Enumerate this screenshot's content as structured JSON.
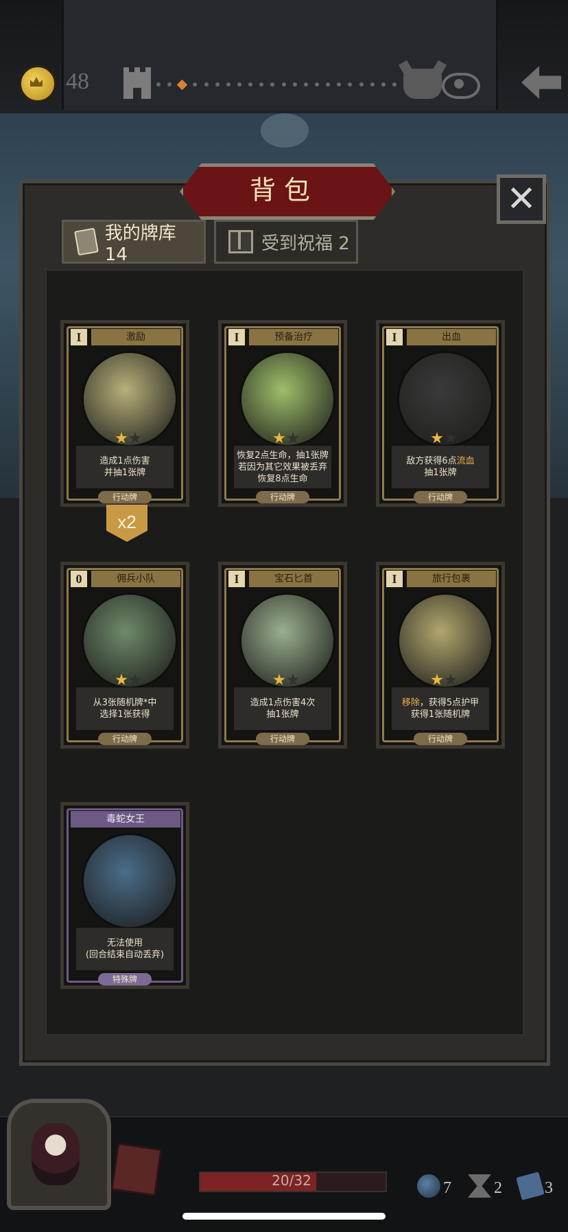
{
  "header": {
    "gold": "48",
    "path_dot_count": 22,
    "path_current_index": 2
  },
  "panel": {
    "title": "背包",
    "close_label": "✕",
    "tabs": [
      {
        "label": "我的牌库 14"
      },
      {
        "label": "受到祝福 2"
      }
    ]
  },
  "cards": [
    {
      "name": "激励",
      "cost": "I",
      "stars": 1,
      "desc": "造成1点伤害\n并抽1张牌",
      "type": "行动牌",
      "art_color": "#b7b07a"
    },
    {
      "name": "预备治疗",
      "cost": "I",
      "stars": 1,
      "desc": "恢复2点生命，抽1张牌\n若因为其它效果被丢弃\n恢复8点生命",
      "type": "行动牌",
      "art_color": "#9fbf6a"
    },
    {
      "name": "出血",
      "cost": "I",
      "stars": 1,
      "desc_parts": [
        "敌方获得6点",
        "流血",
        "\n抽1张牌"
      ],
      "type": "行动牌",
      "art_color": "#3a3a3a"
    },
    {
      "name": "佣兵小队",
      "cost": "0",
      "stars": 1,
      "desc": "从3张随机牌*中\n选择1张获得",
      "type": "行动牌",
      "art_color": "#6f8a6a"
    },
    {
      "name": "宝石匕首",
      "cost": "I",
      "stars": 1,
      "desc": "造成1点伤害4次\n抽1张牌",
      "type": "行动牌",
      "art_color": "#9ab08f"
    },
    {
      "name": "旅行包裹",
      "cost": "I",
      "stars": 1,
      "desc_parts": [
        "移除",
        "，获得5点护甲\n获得1张随机牌"
      ],
      "type": "行动牌",
      "art_color": "#b1a76e"
    },
    {
      "name": "毒蛇女王",
      "cost": "",
      "stars": 0,
      "desc": "无法使用\n(回合结束自动丢弃)",
      "type": "特殊牌",
      "art_color": "#4a6d8a"
    }
  ],
  "first_card_count": "x2",
  "footer": {
    "hp_text": "20/32",
    "hp_fraction": 0.625,
    "bombs": "7",
    "hourglass": "2",
    "card_stat": "3"
  }
}
